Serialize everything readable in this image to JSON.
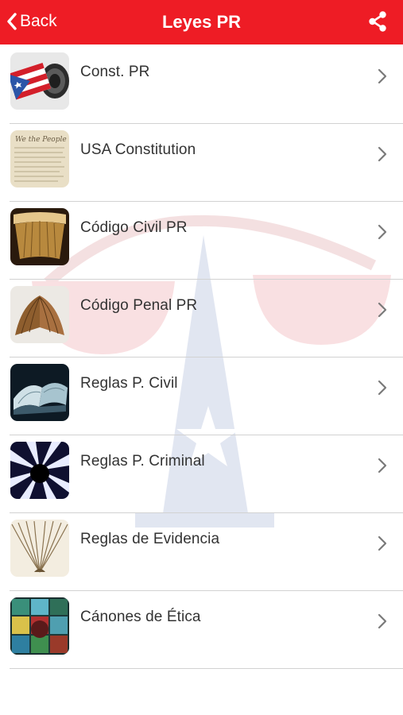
{
  "header": {
    "back_label": "Back",
    "title": "Leyes PR",
    "color": "#ee1c25"
  },
  "icons": {
    "back": "chevron-left-icon",
    "share": "share-icon",
    "row_arrow": "chevron-right-icon"
  },
  "items": [
    {
      "label": "Const. PR"
    },
    {
      "label": "USA Constitution"
    },
    {
      "label": "Código Civil PR"
    },
    {
      "label": "Código Penal PR"
    },
    {
      "label": "Reglas P. Civil"
    },
    {
      "label": "Reglas P. Criminal"
    },
    {
      "label": "Reglas de Evidencia"
    },
    {
      "label": "Cánones de Ética"
    }
  ]
}
